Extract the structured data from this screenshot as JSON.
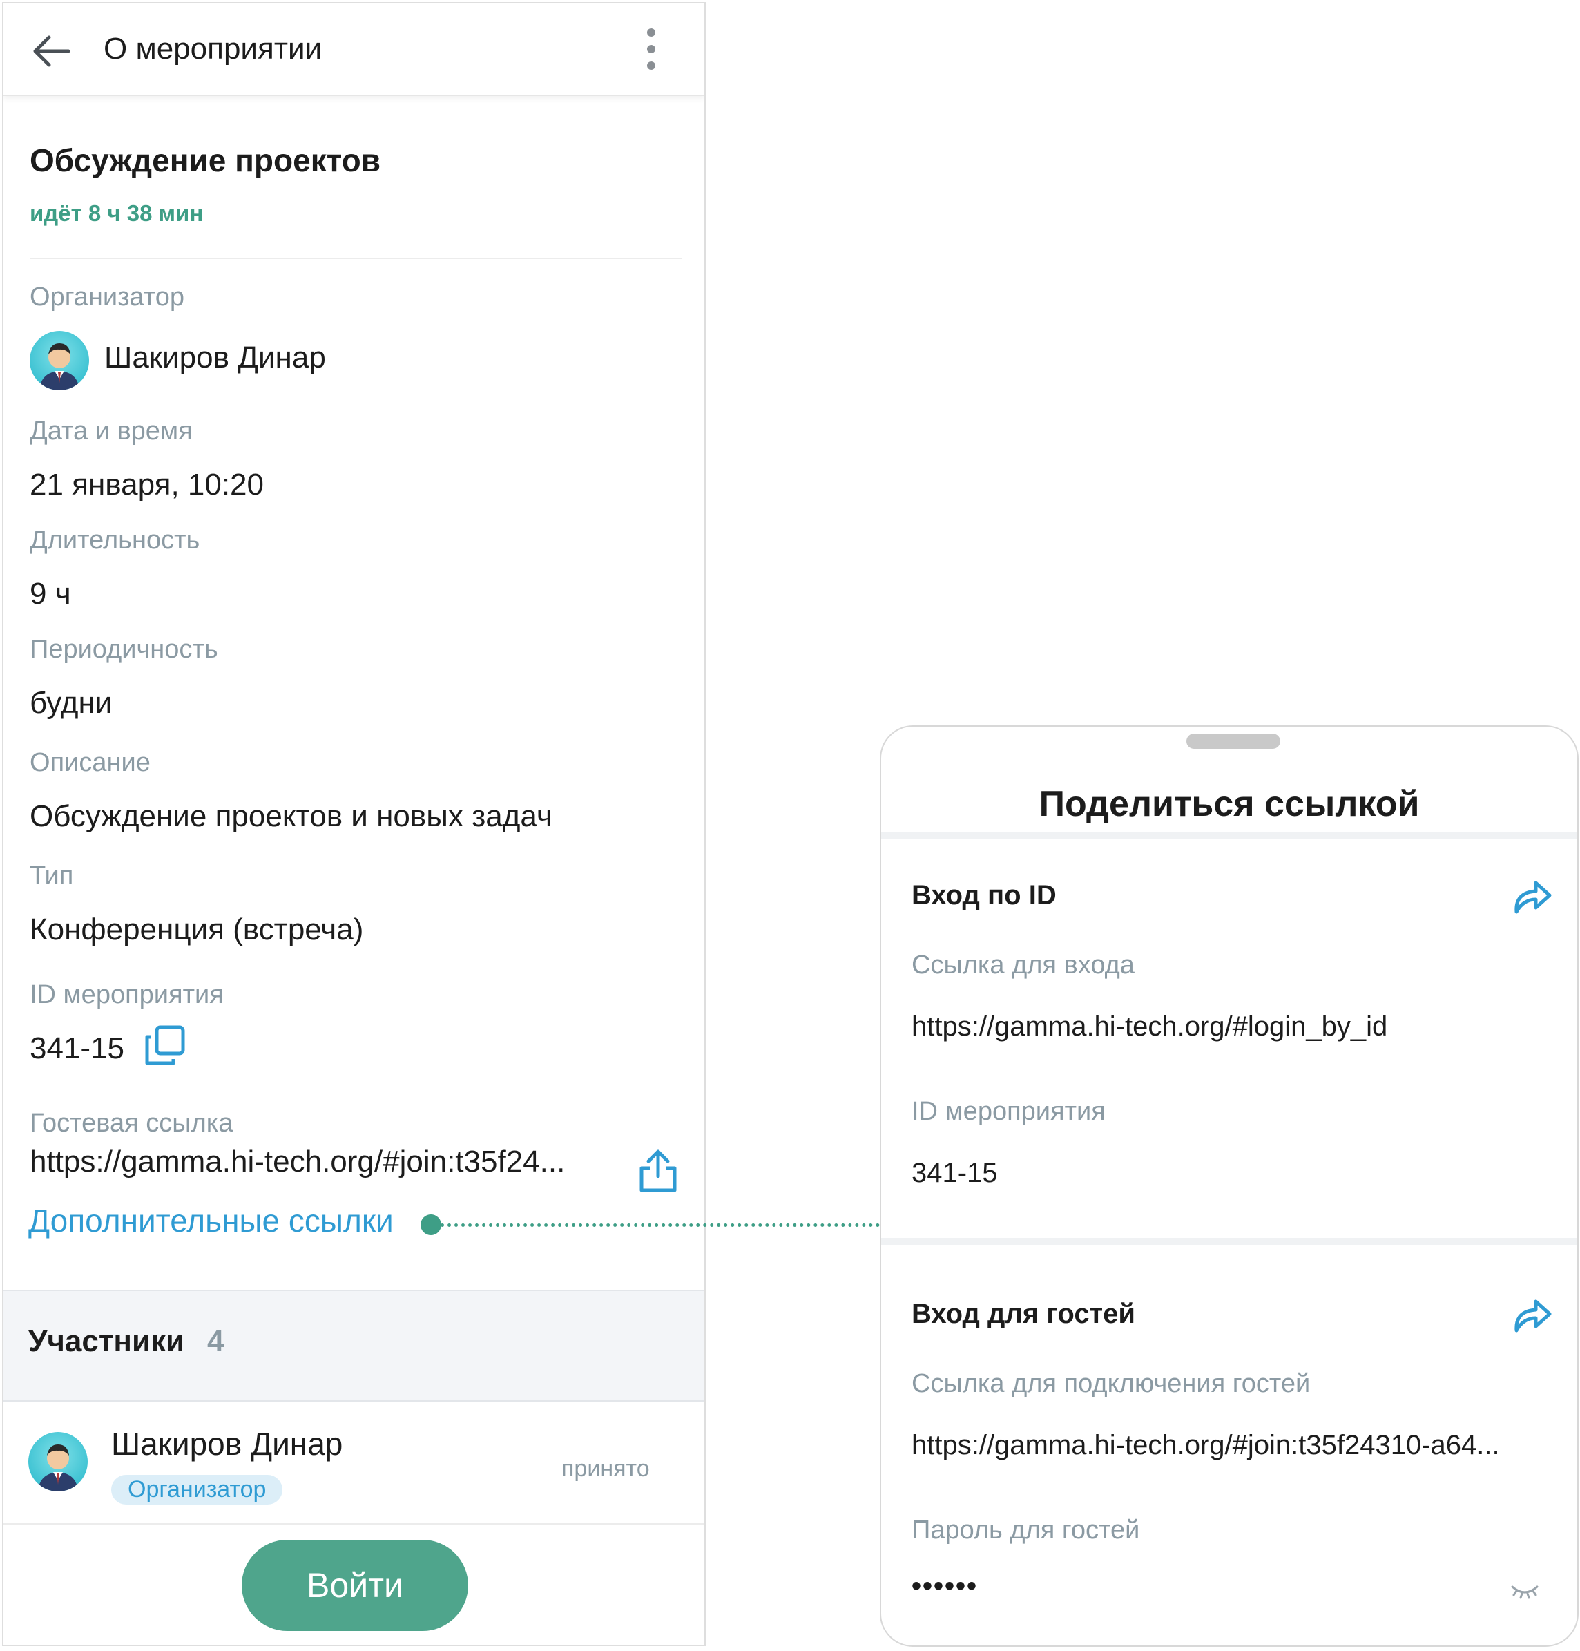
{
  "appbar": {
    "title": "О мероприятии"
  },
  "event": {
    "title": "Обсуждение проектов",
    "status": "идёт  8 ч 38 мин"
  },
  "details": {
    "organizer_label": "Организатор",
    "organizer_name": "Шакиров Динар",
    "datetime_label": "Дата и время",
    "datetime_value": "21 января, 10:20",
    "duration_label": "Длительность",
    "duration_value": "9 ч",
    "periodicity_label": "Периодичность",
    "periodicity_value": "будни",
    "description_label": "Описание",
    "description_value": "Обсуждение проектов и новых задач",
    "type_label": "Тип",
    "type_value": "Конференция (встреча)",
    "id_label": "ID мероприятия",
    "id_value": "341-15",
    "guest_link_label": "Гостевая ссылка",
    "guest_link_value": "https://gamma.hi-tech.org/#join:t35f24...",
    "extra_links": "Дополнительные ссылки"
  },
  "participants": {
    "title": "Участники",
    "count": "4",
    "items": [
      {
        "name": "Шакиров Динар",
        "role": "Организатор",
        "status": "принято"
      }
    ]
  },
  "join_button": "Войти",
  "share_sheet": {
    "title": "Поделиться ссылкой",
    "by_id": {
      "title": "Вход по ID",
      "link_label": "Ссылка для входа",
      "link_value": "https://gamma.hi-tech.org/#login_by_id",
      "id_label": "ID мероприятия",
      "id_value": "341-15"
    },
    "guests": {
      "title": "Вход для гостей",
      "link_label": "Ссылка для подключения гостей",
      "link_value": "https://gamma.hi-tech.org/#join:t35f24310-a64...",
      "password_label": "Пароль для гостей",
      "password_value": "••••••"
    }
  },
  "colors": {
    "accent_green": "#3e9e86",
    "button_green": "#4fa58c",
    "link_blue": "#2f9bd3",
    "label_gray": "#8b9aa3"
  }
}
